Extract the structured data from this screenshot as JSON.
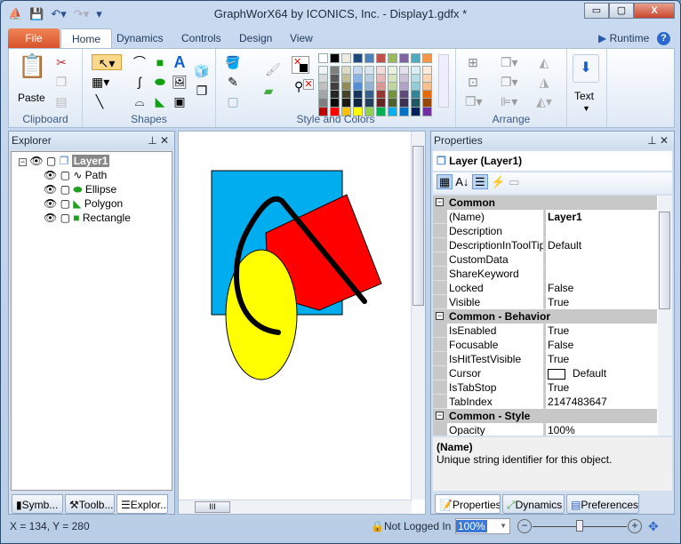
{
  "window": {
    "title": "GraphWorX64 by ICONICS, Inc. - Display1.gdfx *",
    "minimize": "▭",
    "maximize": "▢",
    "close": "X"
  },
  "qat": {
    "icons": [
      "app-icon",
      "save-icon",
      "undo-icon",
      "redo-icon",
      "customize-icon"
    ]
  },
  "tabs": [
    {
      "label": "File"
    },
    {
      "label": "Home"
    },
    {
      "label": "Dynamics"
    },
    {
      "label": "Controls"
    },
    {
      "label": "Design"
    },
    {
      "label": "View"
    }
  ],
  "runtime_label": "Runtime",
  "ribbon": {
    "groups": {
      "clipboard": "Clipboard",
      "shapes": "Shapes",
      "style": "Style and Colors",
      "arrange": "Arrange"
    },
    "paste": "Paste",
    "text": "Text",
    "palette_top": [
      "#ffffff",
      "#000000",
      "#eeece1",
      "#1f497d",
      "#4f81bd",
      "#c0504d",
      "#9bbb59",
      "#8064a2",
      "#4bacc6",
      "#f79646"
    ],
    "palette_shades": [
      [
        "#f2f2f2",
        "#d8d8d8",
        "#bfbfbf",
        "#a5a5a5",
        "#7f7f7f"
      ],
      [
        "#7f7f7f",
        "#595959",
        "#3f3f3f",
        "#262626",
        "#0c0c0c"
      ],
      [
        "#ddd9c3",
        "#c4bd97",
        "#938953",
        "#494429",
        "#1d1b10"
      ],
      [
        "#c6d9f0",
        "#8db3e2",
        "#548dd4",
        "#17365d",
        "#0f243e"
      ],
      [
        "#dbe5f1",
        "#b8cce4",
        "#95b3d7",
        "#366092",
        "#244061"
      ],
      [
        "#f2dcdb",
        "#e5b9b7",
        "#d99694",
        "#953734",
        "#632423"
      ],
      [
        "#ebf1dd",
        "#d7e3bc",
        "#c3d69b",
        "#76923c",
        "#4f6128"
      ],
      [
        "#e5e0ec",
        "#ccc1d9",
        "#b2a2c7",
        "#5f497a",
        "#3f3151"
      ],
      [
        "#dbeef3",
        "#b7dde8",
        "#92cddc",
        "#31859b",
        "#205867"
      ],
      [
        "#fdeada",
        "#fbd5b5",
        "#fac08f",
        "#e36c09",
        "#974806"
      ]
    ],
    "palette_standard": [
      "#c00000",
      "#ff0000",
      "#ffc000",
      "#ffff00",
      "#92d050",
      "#00b050",
      "#00b0f0",
      "#0070c0",
      "#002060",
      "#7030a0"
    ]
  },
  "explorer": {
    "title": "Explorer",
    "root": "Layer1",
    "items": [
      {
        "label": "Path",
        "icon": "path-icon"
      },
      {
        "label": "Ellipse",
        "icon": "ellipse-icon"
      },
      {
        "label": "Polygon",
        "icon": "polygon-icon"
      },
      {
        "label": "Rectangle",
        "icon": "rectangle-icon"
      }
    ],
    "tabs": [
      "Symb...",
      "Toolb...",
      "Explor..."
    ]
  },
  "canvas": {
    "colors": {
      "rectangle": "#00aeef",
      "polygon": "#ff0000",
      "ellipse": "#ffff00",
      "path": "#000000"
    }
  },
  "properties": {
    "title": "Properties",
    "object": "Layer (Layer1)",
    "categories": [
      {
        "name": "Common",
        "rows": [
          [
            "(Name)",
            "Layer1"
          ],
          [
            "Description",
            ""
          ],
          [
            "DescriptionInToolTip",
            "Default"
          ],
          [
            "CustomData",
            ""
          ],
          [
            "ShareKeyword",
            ""
          ],
          [
            "Locked",
            "False"
          ],
          [
            "Visible",
            "True"
          ]
        ]
      },
      {
        "name": "Common - Behavior",
        "rows": [
          [
            "IsEnabled",
            "True"
          ],
          [
            "Focusable",
            "False"
          ],
          [
            "IsHitTestVisible",
            "True"
          ],
          [
            "Cursor",
            "Default"
          ],
          [
            "IsTabStop",
            "True"
          ],
          [
            "TabIndex",
            "2147483647"
          ]
        ]
      },
      {
        "name": "Common - Style",
        "rows": [
          [
            "Opacity",
            "100%"
          ]
        ]
      }
    ],
    "desc_title": "(Name)",
    "desc_text": "Unique string identifier for this object.",
    "tabs": [
      "Properties",
      "Dynamics",
      "Preferences"
    ]
  },
  "status": {
    "coords": "X = 134, Y = 280",
    "login": "Not Logged In",
    "zoom": "100%",
    "zoom_level": 0.5
  }
}
